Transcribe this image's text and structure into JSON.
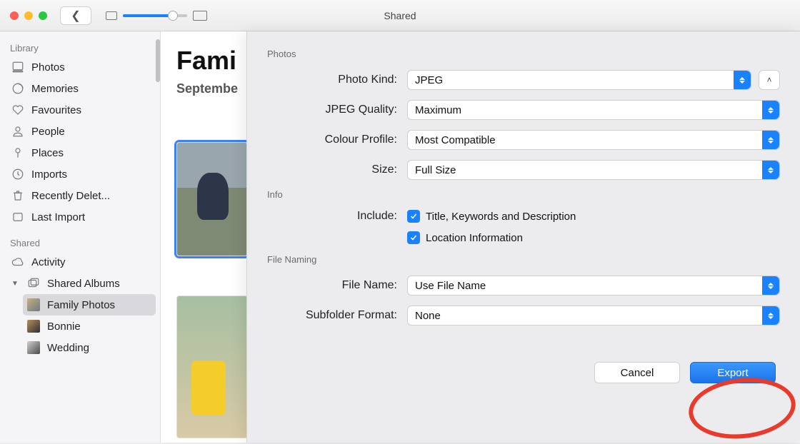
{
  "window": {
    "title": "Shared"
  },
  "sidebar": {
    "sections": [
      {
        "header": "Library",
        "items": [
          {
            "label": "Photos",
            "icon": "photos-icon"
          },
          {
            "label": "Memories",
            "icon": "memories-icon"
          },
          {
            "label": "Favourites",
            "icon": "heart-icon"
          },
          {
            "label": "People",
            "icon": "person-icon"
          },
          {
            "label": "Places",
            "icon": "pin-icon"
          },
          {
            "label": "Imports",
            "icon": "clock-icon"
          },
          {
            "label": "Recently Delet...",
            "icon": "trash-icon"
          },
          {
            "label": "Last Import",
            "icon": "import-icon"
          }
        ]
      },
      {
        "header": "Shared",
        "items": [
          {
            "label": "Activity",
            "icon": "cloud-icon"
          },
          {
            "label": "Shared Albums",
            "icon": "albums-icon",
            "disclosure": "open",
            "children": [
              {
                "label": "Family Photos",
                "selected": true
              },
              {
                "label": "Bonnie"
              },
              {
                "label": "Wedding"
              }
            ]
          }
        ]
      }
    ]
  },
  "content": {
    "title": "Fami",
    "subtitle": "Septembe"
  },
  "sheet": {
    "sections": {
      "photos": {
        "header": "Photos",
        "photo_kind": {
          "label": "Photo Kind:",
          "value": "JPEG"
        },
        "jpeg_quality": {
          "label": "JPEG Quality:",
          "value": "Maximum"
        },
        "colour_profile": {
          "label": "Colour Profile:",
          "value": "Most Compatible"
        },
        "size": {
          "label": "Size:",
          "value": "Full Size"
        }
      },
      "info": {
        "header": "Info",
        "include_label": "Include:",
        "title_keywords": {
          "checked": true,
          "label": "Title, Keywords and Description"
        },
        "location": {
          "checked": true,
          "label": "Location Information"
        }
      },
      "file_naming": {
        "header": "File Naming",
        "file_name": {
          "label": "File Name:",
          "value": "Use File Name"
        },
        "subfolder_format": {
          "label": "Subfolder Format:",
          "value": "None"
        }
      }
    },
    "buttons": {
      "cancel": "Cancel",
      "export": "Export"
    }
  }
}
